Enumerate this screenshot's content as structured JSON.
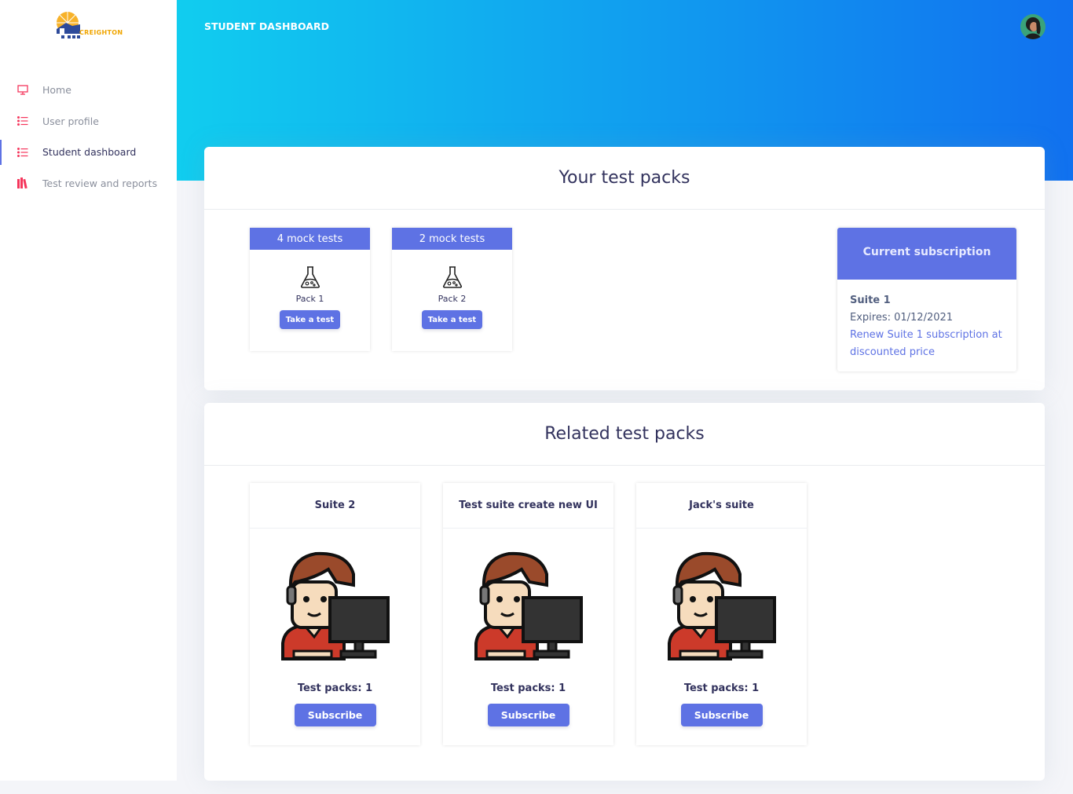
{
  "brand": {
    "logo_text": "CREIGHTON"
  },
  "sidebar": {
    "items": [
      {
        "label": "Home",
        "icon": "monitor-icon"
      },
      {
        "label": "User profile",
        "icon": "list-icon"
      },
      {
        "label": "Student dashboard",
        "icon": "list-icon"
      },
      {
        "label": "Test review and reports",
        "icon": "books-icon"
      }
    ],
    "active_index": 2
  },
  "header": {
    "title": "STUDENT DASHBOARD"
  },
  "your_packs": {
    "title": "Your test packs",
    "packs": [
      {
        "count_label": "4 mock tests",
        "name": "Pack 1",
        "button": "Take a test"
      },
      {
        "count_label": "2 mock tests",
        "name": "Pack 2",
        "button": "Take a test"
      }
    ],
    "subscription": {
      "heading": "Current subscription",
      "suite": "Suite 1",
      "expires": "Expires: 01/12/2021",
      "renew_link": "Renew Suite 1 subscription at discounted price"
    }
  },
  "related_packs": {
    "title": "Related test packs",
    "suites": [
      {
        "name": "Suite 2",
        "packs_label": "Test packs: 1",
        "button": "Subscribe"
      },
      {
        "name": "Test suite create new UI",
        "packs_label": "Test packs: 1",
        "button": "Subscribe"
      },
      {
        "name": "Jack's suite",
        "packs_label": "Test packs: 1",
        "button": "Subscribe"
      }
    ]
  },
  "colors": {
    "accent": "#5e72e4",
    "gradient_start": "#11cdef",
    "gradient_end": "#1171ef",
    "sidebar_icon": "#f5365c"
  }
}
